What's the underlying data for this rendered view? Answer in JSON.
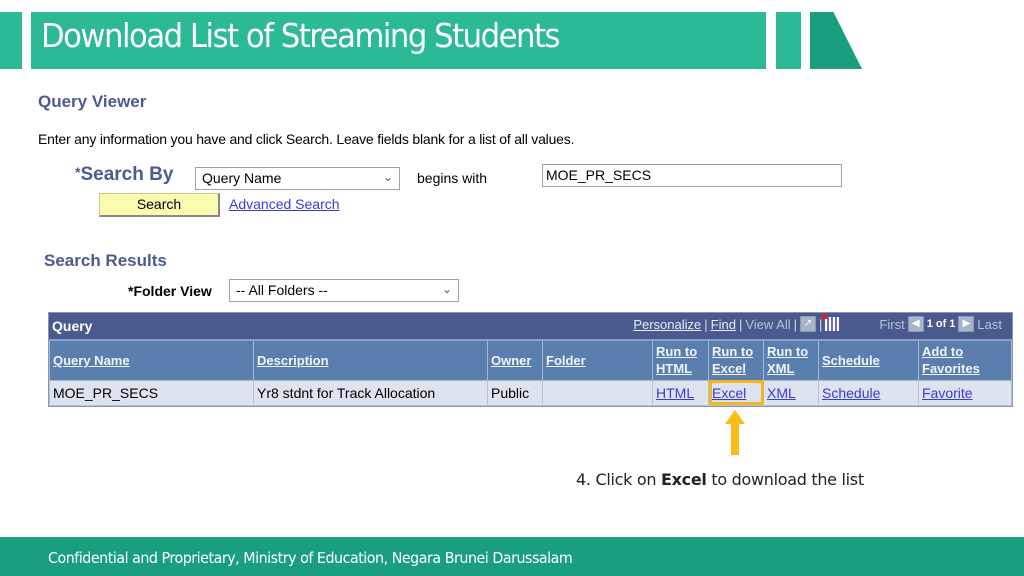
{
  "slide": {
    "title": "Download List of Streaming Students",
    "footer": "Confidential and Proprietary, Ministry of Education, Negara Brunei Darussalam",
    "accent_color": "#2bb996",
    "footer_color": "#1a9e80"
  },
  "query_viewer": {
    "title": "Query Viewer",
    "instructions": "Enter any information you have and click Search. Leave fields blank for a list of all values.",
    "search_by_required_mark": "*",
    "search_by_label": "Search By",
    "search_by_selected": "Query Name",
    "operator_label": "begins with",
    "search_value": "MOE_PR_SECS",
    "search_button": "Search",
    "advanced_search_link": "Advanced Search"
  },
  "search_results": {
    "title": "Search Results",
    "folder_view_label": "*Folder View",
    "folder_view_selected": "-- All Folders --",
    "grid": {
      "title": "Query",
      "nav": {
        "personalize": "Personalize",
        "find": "Find",
        "view_all": "View All",
        "first": "First",
        "page_status": "1 of 1",
        "last": "Last"
      },
      "columns": [
        "Query Name",
        "Description",
        "Owner",
        "Folder",
        "Run to HTML",
        "Run to Excel",
        "Run to XML",
        "Schedule",
        "Add to Favorites"
      ],
      "rows": [
        {
          "query_name": "MOE_PR_SECS",
          "description": "Yr8 stdnt for Track Allocation",
          "owner": "Public",
          "folder": "",
          "run_html": "HTML",
          "run_excel": "Excel",
          "run_xml": "XML",
          "schedule": "Schedule",
          "favorite": "Favorite"
        }
      ]
    }
  },
  "annotation": {
    "step_prefix": "4. Click on ",
    "step_bold": "Excel",
    "step_suffix": " to download the list",
    "highlight_color": "#f3b61f"
  }
}
